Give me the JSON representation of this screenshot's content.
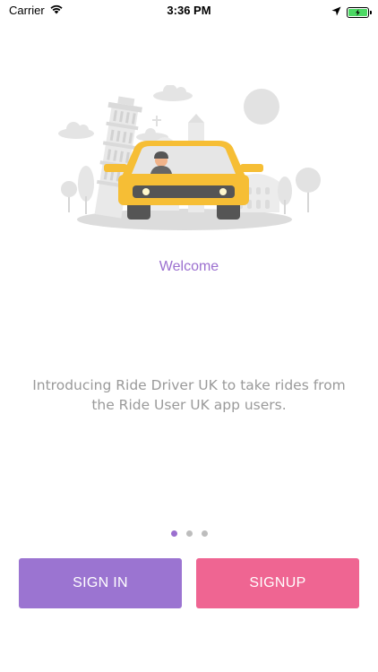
{
  "status_bar": {
    "carrier": "Carrier",
    "time": "3:36 PM",
    "icons": [
      "wifi-icon",
      "location-arrow-icon",
      "battery-charging-icon"
    ],
    "battery_color": "#4cd964"
  },
  "onboarding": {
    "title": "Welcome",
    "description": "Introducing Ride Driver UK to take rides from the Ride User UK app users.",
    "page_count": 3,
    "current_page": 1
  },
  "buttons": {
    "sign_in": "SIGN IN",
    "sign_up": "SIGNUP"
  },
  "colors": {
    "accent_purple": "#9b74d1",
    "accent_pink": "#ef6592",
    "car_yellow": "#f6be35",
    "text_gray": "#9a9a9a"
  }
}
